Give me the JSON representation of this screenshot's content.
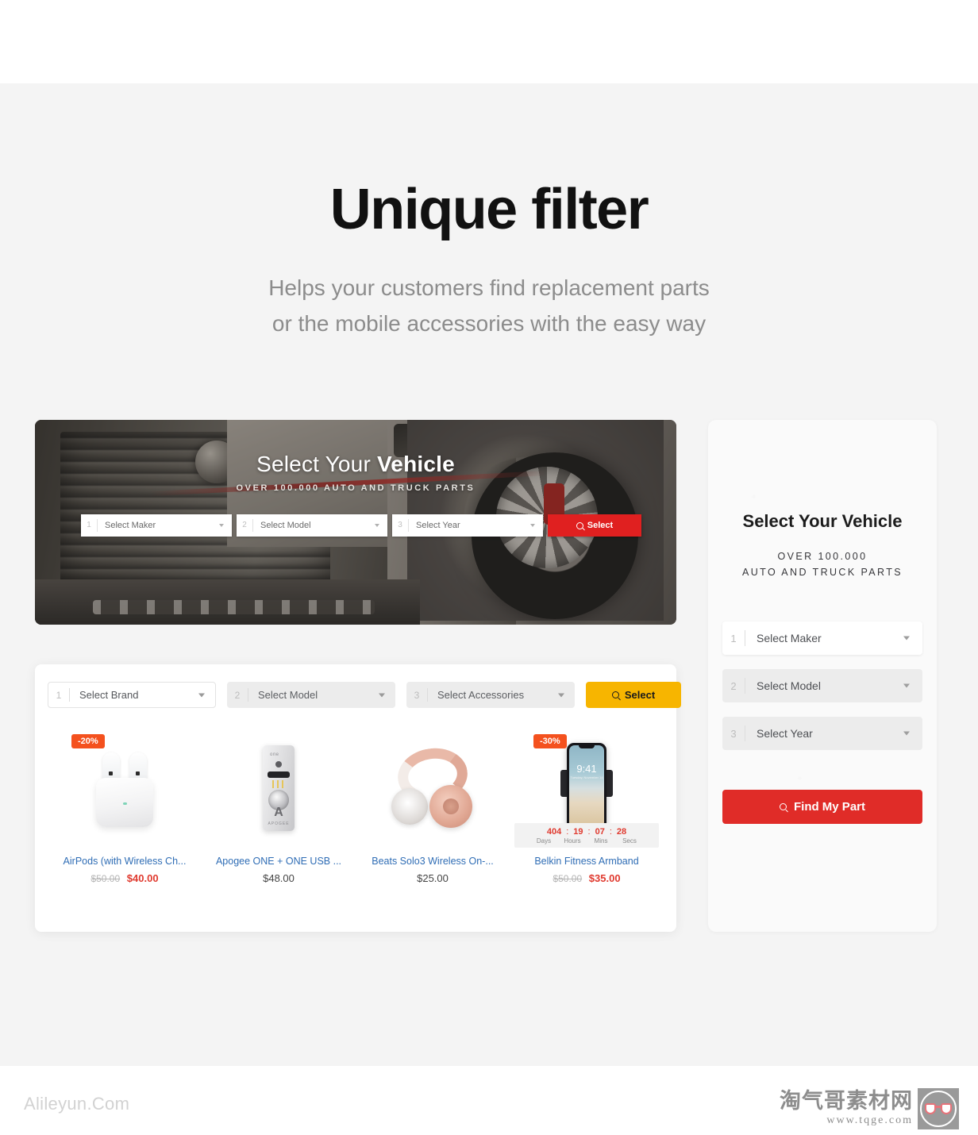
{
  "headline": "Unique filter",
  "subhead": {
    "line1": "Helps your customers find replacement parts",
    "line2": "or the mobile accessories with the easy way"
  },
  "hero": {
    "title_light": "Select Your ",
    "title_bold": "Vehicle",
    "subtitle": "OVER 100.000 AUTO AND TRUCK PARTS",
    "selects": [
      {
        "num": "1",
        "label": "Select Maker"
      },
      {
        "num": "2",
        "label": "Select Model"
      },
      {
        "num": "3",
        "label": "Select Year"
      }
    ],
    "button_label": "Select",
    "button_color": "#e02020"
  },
  "products_panel": {
    "selects": [
      {
        "num": "1",
        "label": "Select Brand",
        "state": "active"
      },
      {
        "num": "2",
        "label": "Select Model",
        "state": "muted"
      },
      {
        "num": "3",
        "label": "Select Accessories",
        "state": "muted"
      }
    ],
    "button_label": "Select",
    "button_color": "#f7b500",
    "products": [
      {
        "name": "AirPods (with Wireless Ch...",
        "badge": "-20%",
        "old_price": "$50.00",
        "price": "$40.00",
        "has_discount": true,
        "has_timer": false
      },
      {
        "name": "Apogee ONE + ONE USB ...",
        "badge": "",
        "old_price": "",
        "price": "$48.00",
        "has_discount": false,
        "has_timer": false
      },
      {
        "name": "Beats Solo3 Wireless On-...",
        "badge": "",
        "old_price": "",
        "price": "$25.00",
        "has_discount": false,
        "has_timer": false
      },
      {
        "name": "Belkin Fitness Armband",
        "badge": "-30%",
        "old_price": "$50.00",
        "price": "$35.00",
        "has_discount": true,
        "has_timer": true,
        "timer": {
          "days": "404",
          "hours": "19",
          "mins": "07",
          "secs": "28",
          "days_label": "Days",
          "hours_label": "Hours",
          "mins_label": "Mins",
          "secs_label": "Secs",
          "separator": ":"
        }
      }
    ]
  },
  "side_panel": {
    "title": "Select Your Vehicle",
    "subtitle_line1": "OVER 100.000",
    "subtitle_line2": "AUTO AND TRUCK PARTS",
    "selects": [
      {
        "num": "1",
        "label": "Select Maker"
      },
      {
        "num": "2",
        "label": "Select Model"
      },
      {
        "num": "3",
        "label": "Select Year"
      }
    ],
    "button_label": "Find My Part",
    "button_color": "#e02c28"
  },
  "watermarks": {
    "left": "Alileyun.Com",
    "right_cn": "淘气哥素材网",
    "right_url": "www.tqge.com"
  },
  "phone_mock": {
    "time": "9:41",
    "date": "Tuesday, November 14"
  }
}
